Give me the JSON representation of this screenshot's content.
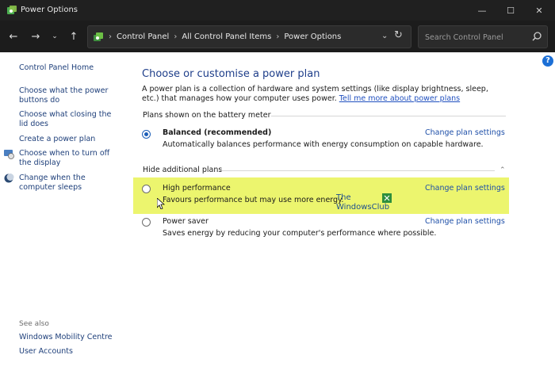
{
  "window": {
    "title": "Power Options"
  },
  "address": {
    "crumbs": [
      "Control Panel",
      "All Control Panel Items",
      "Power Options"
    ]
  },
  "search": {
    "placeholder": "Search Control Panel"
  },
  "sidebar": {
    "home": "Control Panel Home",
    "links": [
      "Choose what the power buttons do",
      "Choose what closing the lid does",
      "Create a power plan",
      "Choose when to turn off the display",
      "Change when the computer sleeps"
    ],
    "see_also": "See also",
    "see_also_links": [
      "Windows Mobility Centre",
      "User Accounts"
    ]
  },
  "main": {
    "title": "Choose or customise a power plan",
    "description": "A power plan is a collection of hardware and system settings (like display brightness, sleep, etc.) that manages how your computer uses power.",
    "learn_more": "Tell me more about power plans",
    "battery_section": "Plans shown on the battery meter",
    "additional_section": "Hide additional plans",
    "change_label": "Change plan settings",
    "plans": [
      {
        "name": "Balanced (recommended)",
        "desc": "Automatically balances performance with energy consumption on capable hardware.",
        "selected": true
      },
      {
        "name": "High performance",
        "desc": "Favours performance but may use more energy.",
        "selected": false
      },
      {
        "name": "Power saver",
        "desc": "Saves energy by reducing your computer's performance where possible.",
        "selected": false
      }
    ]
  },
  "watermark": {
    "line1": "The",
    "line2": "WindowsClub"
  },
  "colors": {
    "highlight": "#ecf56e",
    "link": "#1e4fa8",
    "accent": "#1d5fb8"
  }
}
